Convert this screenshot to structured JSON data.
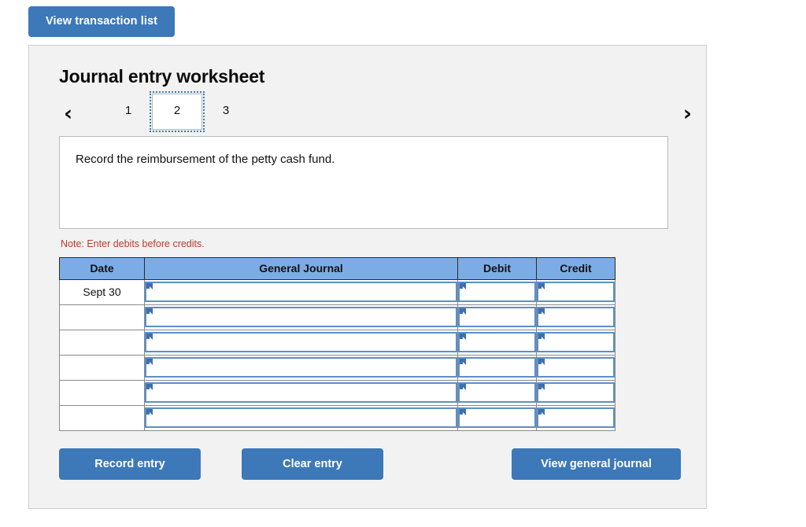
{
  "top": {
    "view_transaction_list_label": "View transaction list"
  },
  "worksheet": {
    "title": "Journal entry worksheet",
    "pager": {
      "prev_icon": "‹",
      "next_icon": "›",
      "tabs": [
        {
          "label": "1",
          "selected": false
        },
        {
          "label": "2",
          "selected": true
        },
        {
          "label": "3",
          "selected": false
        }
      ]
    },
    "prompt": "Record the reimbursement of the petty cash fund.",
    "note": "Note: Enter debits before credits.",
    "table": {
      "headers": [
        "Date",
        "General Journal",
        "Debit",
        "Credit"
      ],
      "rows": [
        {
          "date": "Sept 30",
          "general_journal": "",
          "debit": "",
          "credit": ""
        },
        {
          "date": "",
          "general_journal": "",
          "debit": "",
          "credit": ""
        },
        {
          "date": "",
          "general_journal": "",
          "debit": "",
          "credit": ""
        },
        {
          "date": "",
          "general_journal": "",
          "debit": "",
          "credit": ""
        },
        {
          "date": "",
          "general_journal": "",
          "debit": "",
          "credit": ""
        },
        {
          "date": "",
          "general_journal": "",
          "debit": "",
          "credit": ""
        }
      ]
    },
    "footer": {
      "record_entry_label": "Record entry",
      "clear_entry_label": "Clear entry",
      "view_general_journal_label": "View general journal"
    }
  },
  "colors": {
    "button_blue": "#3d78b9",
    "table_header_blue": "#7cace6",
    "field_border_blue": "#5b8fc9",
    "note_red": "#c0392b",
    "panel_bg": "#f2f2f2",
    "panel_border": "#cfcfcf"
  }
}
